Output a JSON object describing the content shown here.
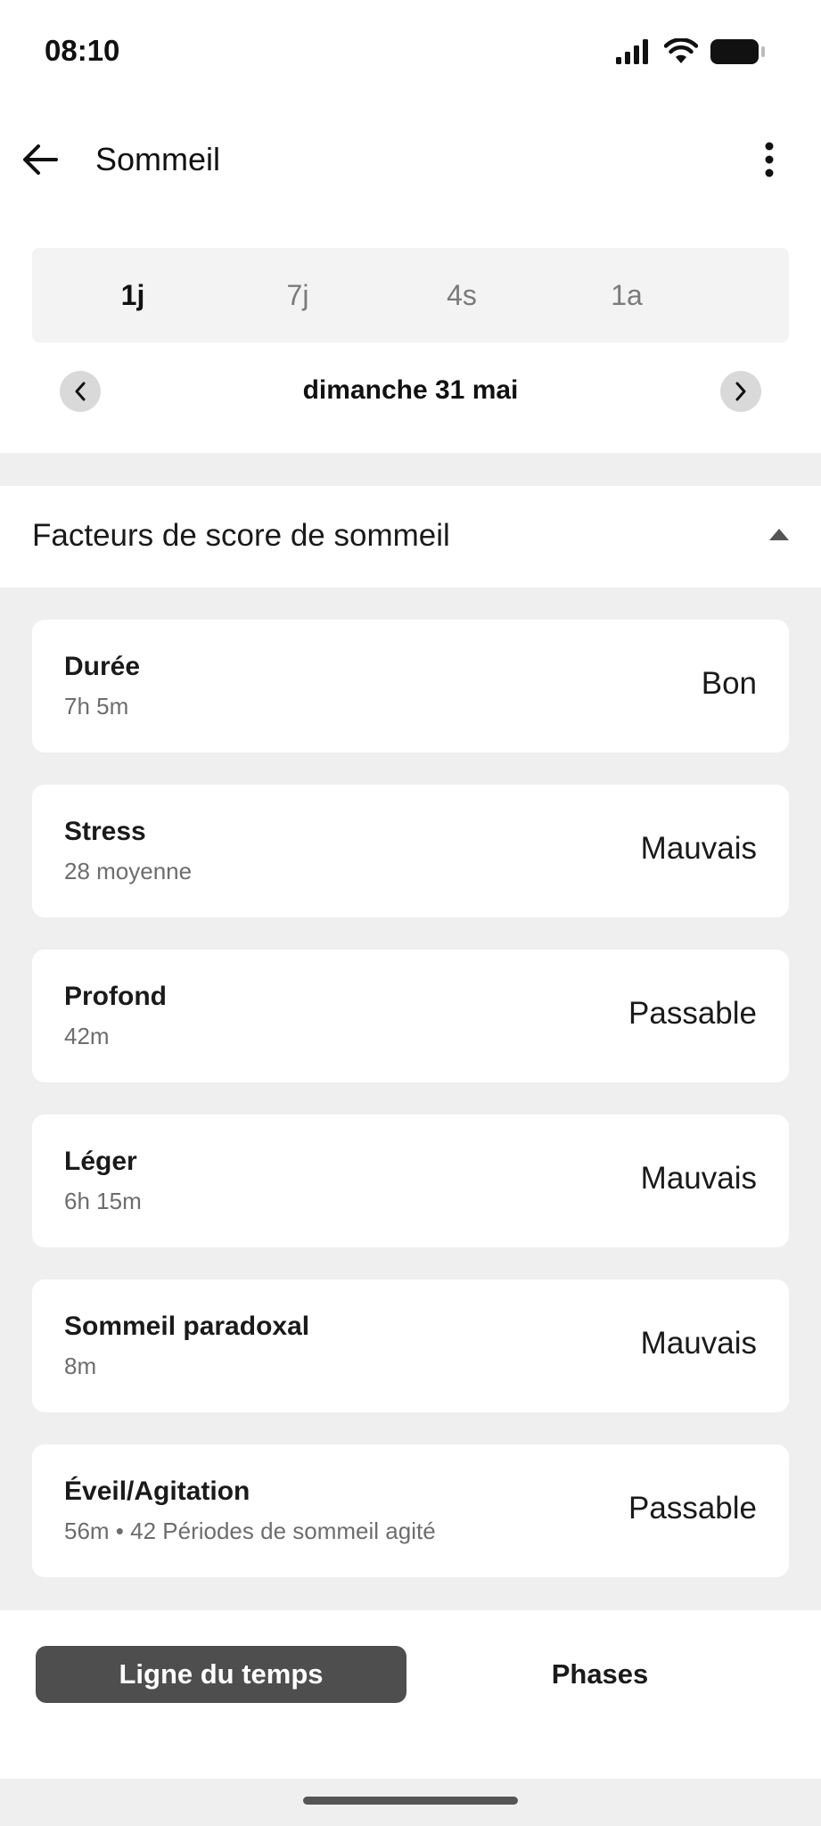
{
  "status_bar": {
    "time": "08:10"
  },
  "header": {
    "title": "Sommeil",
    "back_icon": "arrow-left-icon",
    "menu_icon": "more-vertical-icon"
  },
  "period_tabs": [
    {
      "label": "1j",
      "active": true
    },
    {
      "label": "7j",
      "active": false
    },
    {
      "label": "4s",
      "active": false
    },
    {
      "label": "1a",
      "active": false
    }
  ],
  "date_nav": {
    "label": "dimanche 31 mai"
  },
  "section": {
    "title": "Facteurs de score de sommeil",
    "expanded": true
  },
  "factors": [
    {
      "name": "Durée",
      "detail": "7h 5m",
      "rating": "Bon"
    },
    {
      "name": "Stress",
      "detail": "28 moyenne",
      "rating": "Mauvais"
    },
    {
      "name": "Profond",
      "detail": "42m",
      "rating": "Passable"
    },
    {
      "name": "Léger",
      "detail": "6h 15m",
      "rating": "Mauvais"
    },
    {
      "name": "Sommeil paradoxal",
      "detail": "8m",
      "rating": "Mauvais"
    },
    {
      "name": "Éveil/Agitation",
      "detail": "56m • 42 Périodes de sommeil agité",
      "rating": "Passable"
    }
  ],
  "bottom_views": {
    "timeline": "Ligne du temps",
    "phases": "Phases",
    "active": "timeline"
  },
  "colors": {
    "accent_dark": "#4e4e4e",
    "background": "#efefef",
    "card": "#ffffff"
  }
}
